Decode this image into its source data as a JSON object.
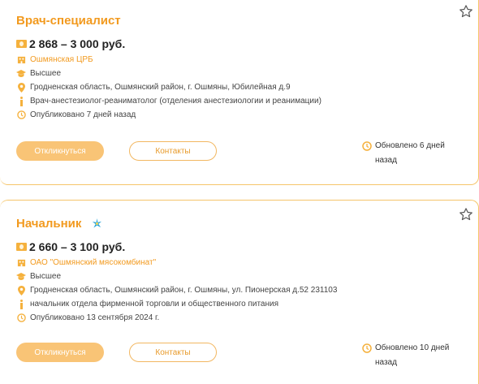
{
  "vacancies": [
    {
      "title": "Врач-специалист",
      "salary": "2 868 – 3 000 руб.",
      "employer": "Ошмянская ЦРБ",
      "education": "Высшее",
      "address": "Гродненская область, Ошмянский район, г. Ошмяны, Юбилейная д.9",
      "description": "Врач-анестезиолог-реаниматолог (отделения анестезиологии и реанимации)",
      "published": "Опубликовано 7 дней назад",
      "apply_label": "Откликнуться",
      "contacts_label": "Контакты",
      "updated": "Обновлено 6 дней назад"
    },
    {
      "title": "Начальник",
      "salary": "2 660 – 3 100 руб.",
      "employer": "ОАО \"Ошмянский мясокомбинат\"",
      "education": "Высшее",
      "address": "Гродненская область, Ошмянский район, г. Ошмяны, ул. Пионерская д.52 231103",
      "description": "начальник отдела фирменной торговли и общественного питания",
      "published": "Опубликовано 13 сентября 2024 г.",
      "apply_label": "Откликнуться",
      "contacts_label": "Контакты",
      "updated": "Обновлено 10 дней назад"
    }
  ],
  "icons": {
    "favorite": "star-outline-icon",
    "salary": "money-icon",
    "employer": "building-icon",
    "education": "graduation-cap-icon",
    "address": "map-pin-icon",
    "description": "info-icon",
    "published": "clock-icon",
    "new": "sparkle-icon"
  },
  "colors": {
    "accent": "#f29a1f",
    "button_fill": "#f9c476",
    "border": "#f5c56a"
  }
}
